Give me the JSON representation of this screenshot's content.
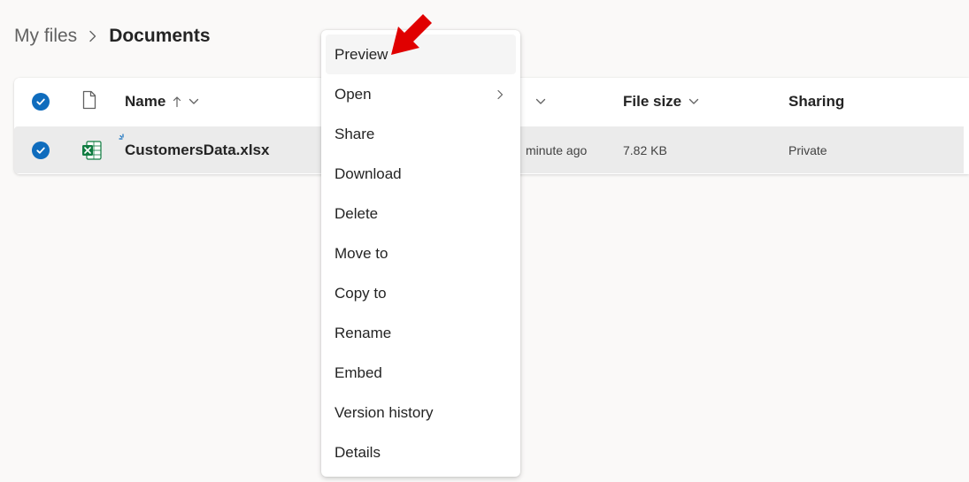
{
  "breadcrumb": {
    "root": "My files",
    "current": "Documents"
  },
  "list": {
    "columns": {
      "name": "Name",
      "modified_partial": "",
      "file_size": "File size",
      "sharing": "Sharing"
    },
    "rows": [
      {
        "name": "CustomersData.xlsx",
        "modified": "minute ago",
        "file_size": "7.82 KB",
        "sharing": "Private",
        "selected": true,
        "file_type": "excel"
      }
    ]
  },
  "context_menu": {
    "items": [
      {
        "label": "Preview",
        "hovered": true
      },
      {
        "label": "Open",
        "has_submenu": true
      },
      {
        "label": "Share"
      },
      {
        "label": "Download"
      },
      {
        "label": "Delete"
      },
      {
        "label": "Move to"
      },
      {
        "label": "Copy to"
      },
      {
        "label": "Rename"
      },
      {
        "label": "Embed"
      },
      {
        "label": "Version history"
      },
      {
        "label": "Details"
      }
    ]
  },
  "icons": {
    "select_all": "checkmark-circle-icon",
    "file_type_header": "document-icon",
    "sort": "arrow-up-icon",
    "column_menu": "chevron-down-icon",
    "row_file": "excel-icon",
    "new_sparkle": "sparkle-icon",
    "submenu": "chevron-right-icon",
    "annotation": "red-arrow-icon"
  },
  "colors": {
    "accent": "#0f6cbd",
    "excel_green": "#107c41",
    "annotation_red": "#e00000",
    "selected_row": "#ebebeb"
  }
}
